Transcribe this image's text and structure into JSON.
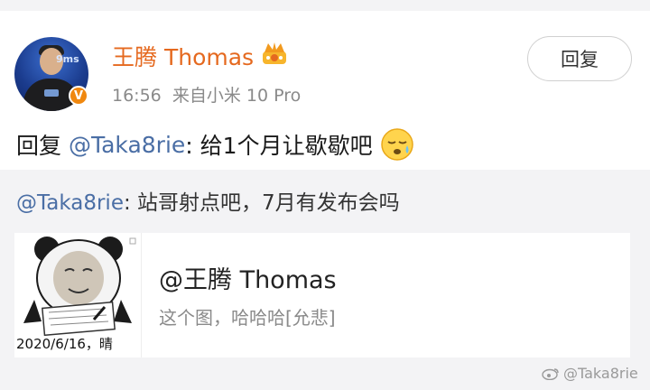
{
  "post": {
    "username": "王腾 Thomas",
    "time": "16:56",
    "source": "来自小米 10 Pro",
    "reply_button": "回复",
    "reply_prefix": "回复",
    "reply_mention": "@Taka8rie",
    "reply_text": ": 给1个月让歇歇吧",
    "emoji": "sleepy-face-icon",
    "avatar_tag": "9ms"
  },
  "quote": {
    "mention": "@Taka8rie",
    "text": ": 站哥射点吧，7月有发布会吗"
  },
  "quoted_card": {
    "username": "@王腾 Thomas",
    "subtitle": "这个图，哈哈哈[允悲]",
    "image_date": "2020/6/16，晴"
  },
  "watermark": {
    "text": "@Taka8rie"
  },
  "colors": {
    "username": "#e5691f",
    "mention": "#4a6ea5",
    "badge": "#f0880f"
  }
}
